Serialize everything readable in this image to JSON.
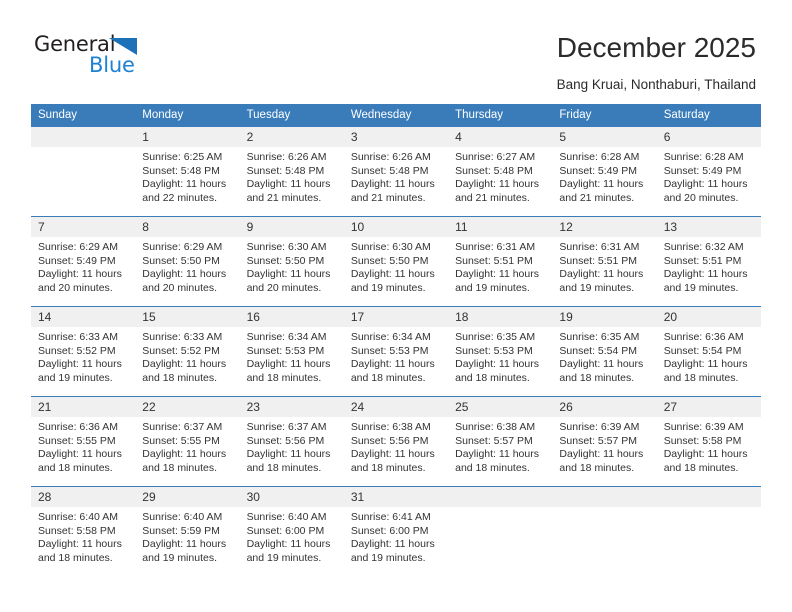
{
  "brand": {
    "name_part1": "General",
    "name_part2": "Blue",
    "triangle_icon": "triangle-icon",
    "accent_color": "#1d82d4",
    "header_color": "#3a7cba"
  },
  "header": {
    "title": "December 2025",
    "subtitle": "Bang Kruai, Nonthaburi, Thailand"
  },
  "calendar": {
    "weekday_headers": [
      "Sunday",
      "Monday",
      "Tuesday",
      "Wednesday",
      "Thursday",
      "Friday",
      "Saturday"
    ],
    "weeks": [
      [
        {
          "day": "",
          "lines": []
        },
        {
          "day": "1",
          "lines": [
            "Sunrise: 6:25 AM",
            "Sunset: 5:48 PM",
            "Daylight: 11 hours",
            "and 22 minutes."
          ]
        },
        {
          "day": "2",
          "lines": [
            "Sunrise: 6:26 AM",
            "Sunset: 5:48 PM",
            "Daylight: 11 hours",
            "and 21 minutes."
          ]
        },
        {
          "day": "3",
          "lines": [
            "Sunrise: 6:26 AM",
            "Sunset: 5:48 PM",
            "Daylight: 11 hours",
            "and 21 minutes."
          ]
        },
        {
          "day": "4",
          "lines": [
            "Sunrise: 6:27 AM",
            "Sunset: 5:48 PM",
            "Daylight: 11 hours",
            "and 21 minutes."
          ]
        },
        {
          "day": "5",
          "lines": [
            "Sunrise: 6:28 AM",
            "Sunset: 5:49 PM",
            "Daylight: 11 hours",
            "and 21 minutes."
          ]
        },
        {
          "day": "6",
          "lines": [
            "Sunrise: 6:28 AM",
            "Sunset: 5:49 PM",
            "Daylight: 11 hours",
            "and 20 minutes."
          ]
        }
      ],
      [
        {
          "day": "7",
          "lines": [
            "Sunrise: 6:29 AM",
            "Sunset: 5:49 PM",
            "Daylight: 11 hours",
            "and 20 minutes."
          ]
        },
        {
          "day": "8",
          "lines": [
            "Sunrise: 6:29 AM",
            "Sunset: 5:50 PM",
            "Daylight: 11 hours",
            "and 20 minutes."
          ]
        },
        {
          "day": "9",
          "lines": [
            "Sunrise: 6:30 AM",
            "Sunset: 5:50 PM",
            "Daylight: 11 hours",
            "and 20 minutes."
          ]
        },
        {
          "day": "10",
          "lines": [
            "Sunrise: 6:30 AM",
            "Sunset: 5:50 PM",
            "Daylight: 11 hours",
            "and 19 minutes."
          ]
        },
        {
          "day": "11",
          "lines": [
            "Sunrise: 6:31 AM",
            "Sunset: 5:51 PM",
            "Daylight: 11 hours",
            "and 19 minutes."
          ]
        },
        {
          "day": "12",
          "lines": [
            "Sunrise: 6:31 AM",
            "Sunset: 5:51 PM",
            "Daylight: 11 hours",
            "and 19 minutes."
          ]
        },
        {
          "day": "13",
          "lines": [
            "Sunrise: 6:32 AM",
            "Sunset: 5:51 PM",
            "Daylight: 11 hours",
            "and 19 minutes."
          ]
        }
      ],
      [
        {
          "day": "14",
          "lines": [
            "Sunrise: 6:33 AM",
            "Sunset: 5:52 PM",
            "Daylight: 11 hours",
            "and 19 minutes."
          ]
        },
        {
          "day": "15",
          "lines": [
            "Sunrise: 6:33 AM",
            "Sunset: 5:52 PM",
            "Daylight: 11 hours",
            "and 18 minutes."
          ]
        },
        {
          "day": "16",
          "lines": [
            "Sunrise: 6:34 AM",
            "Sunset: 5:53 PM",
            "Daylight: 11 hours",
            "and 18 minutes."
          ]
        },
        {
          "day": "17",
          "lines": [
            "Sunrise: 6:34 AM",
            "Sunset: 5:53 PM",
            "Daylight: 11 hours",
            "and 18 minutes."
          ]
        },
        {
          "day": "18",
          "lines": [
            "Sunrise: 6:35 AM",
            "Sunset: 5:53 PM",
            "Daylight: 11 hours",
            "and 18 minutes."
          ]
        },
        {
          "day": "19",
          "lines": [
            "Sunrise: 6:35 AM",
            "Sunset: 5:54 PM",
            "Daylight: 11 hours",
            "and 18 minutes."
          ]
        },
        {
          "day": "20",
          "lines": [
            "Sunrise: 6:36 AM",
            "Sunset: 5:54 PM",
            "Daylight: 11 hours",
            "and 18 minutes."
          ]
        }
      ],
      [
        {
          "day": "21",
          "lines": [
            "Sunrise: 6:36 AM",
            "Sunset: 5:55 PM",
            "Daylight: 11 hours",
            "and 18 minutes."
          ]
        },
        {
          "day": "22",
          "lines": [
            "Sunrise: 6:37 AM",
            "Sunset: 5:55 PM",
            "Daylight: 11 hours",
            "and 18 minutes."
          ]
        },
        {
          "day": "23",
          "lines": [
            "Sunrise: 6:37 AM",
            "Sunset: 5:56 PM",
            "Daylight: 11 hours",
            "and 18 minutes."
          ]
        },
        {
          "day": "24",
          "lines": [
            "Sunrise: 6:38 AM",
            "Sunset: 5:56 PM",
            "Daylight: 11 hours",
            "and 18 minutes."
          ]
        },
        {
          "day": "25",
          "lines": [
            "Sunrise: 6:38 AM",
            "Sunset: 5:57 PM",
            "Daylight: 11 hours",
            "and 18 minutes."
          ]
        },
        {
          "day": "26",
          "lines": [
            "Sunrise: 6:39 AM",
            "Sunset: 5:57 PM",
            "Daylight: 11 hours",
            "and 18 minutes."
          ]
        },
        {
          "day": "27",
          "lines": [
            "Sunrise: 6:39 AM",
            "Sunset: 5:58 PM",
            "Daylight: 11 hours",
            "and 18 minutes."
          ]
        }
      ],
      [
        {
          "day": "28",
          "lines": [
            "Sunrise: 6:40 AM",
            "Sunset: 5:58 PM",
            "Daylight: 11 hours",
            "and 18 minutes."
          ]
        },
        {
          "day": "29",
          "lines": [
            "Sunrise: 6:40 AM",
            "Sunset: 5:59 PM",
            "Daylight: 11 hours",
            "and 19 minutes."
          ]
        },
        {
          "day": "30",
          "lines": [
            "Sunrise: 6:40 AM",
            "Sunset: 6:00 PM",
            "Daylight: 11 hours",
            "and 19 minutes."
          ]
        },
        {
          "day": "31",
          "lines": [
            "Sunrise: 6:41 AM",
            "Sunset: 6:00 PM",
            "Daylight: 11 hours",
            "and 19 minutes."
          ]
        },
        {
          "day": "",
          "lines": []
        },
        {
          "day": "",
          "lines": []
        },
        {
          "day": "",
          "lines": []
        }
      ]
    ]
  }
}
